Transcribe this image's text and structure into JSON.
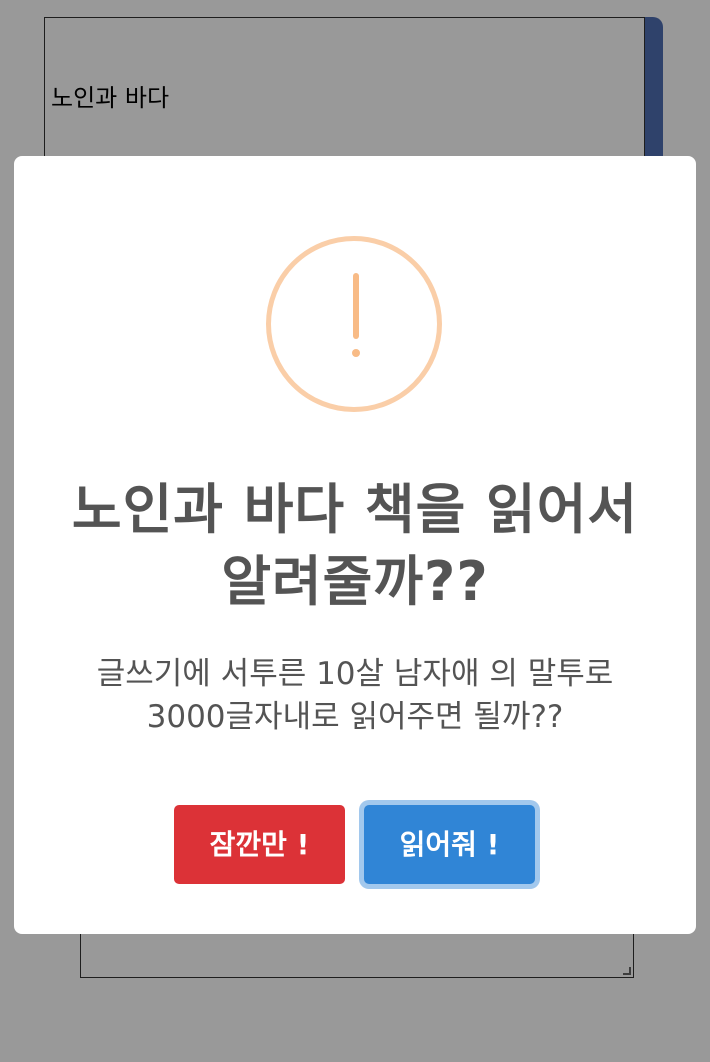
{
  "background": {
    "book_input_value": "노인과 바다"
  },
  "modal": {
    "title": "노인과 바다 책을 읽어서 알려줄까??",
    "text": "글쓰기에 서투른 10살 남자애 의 말투로 3000글자내로 읽어주면 될까??",
    "icon": "warning-icon",
    "cancel_label": "잠깐만 !",
    "confirm_label": "읽어줘 !",
    "colors": {
      "cancel": "#dc3237",
      "confirm": "#3085d6",
      "icon": "#f8bb86",
      "overlay": "rgba(0,0,0,0.4)"
    }
  }
}
